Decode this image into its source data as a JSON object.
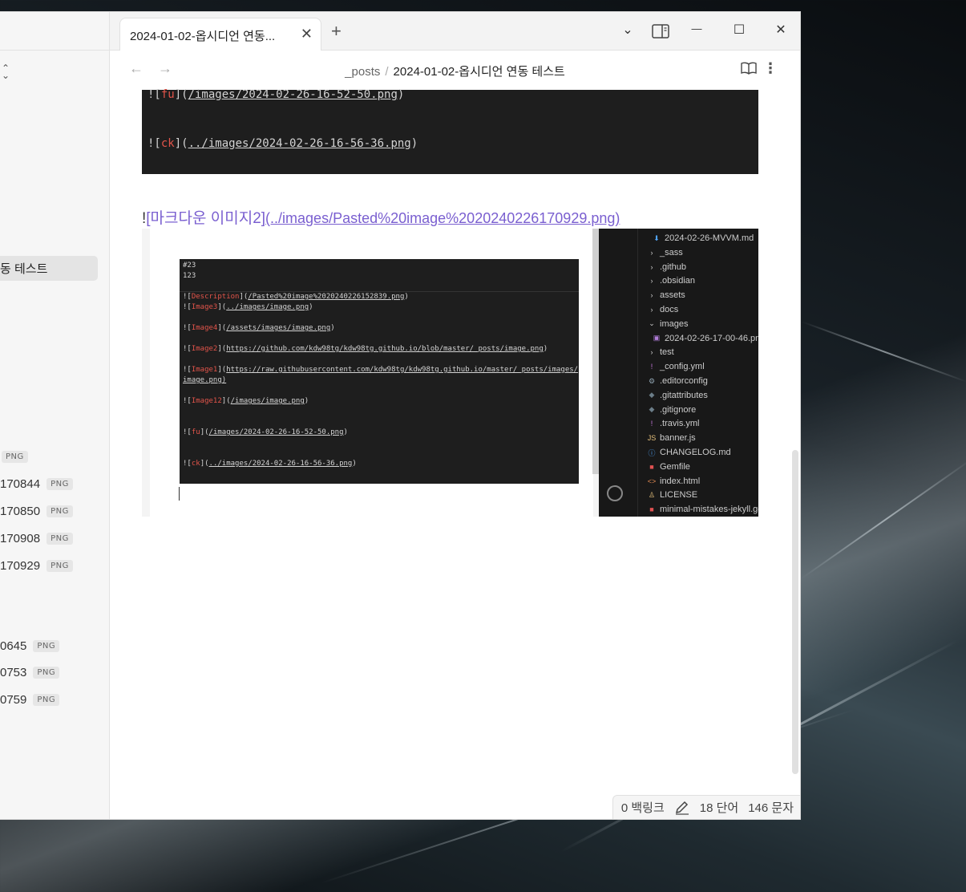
{
  "window": {
    "tab_title": "2024-01-02-옵시디언 연동...",
    "new_tab_symbol": "+",
    "close_tab_symbol": "✕",
    "dropdown_symbol": "⌄",
    "minimize_symbol": "—",
    "maximize_symbol": "☐",
    "close_symbol": "✕"
  },
  "nav": {
    "back_symbol": "←",
    "forward_symbol": "→",
    "breadcrumb_folder": "_posts",
    "breadcrumb_sep": "/",
    "breadcrumb_file": "2024-01-02-옵시디언 연동 테스트",
    "more_symbol": "⋮"
  },
  "sidebar": {
    "active_file": "동 테스트",
    "attachments": [
      {
        "name": "",
        "badge": "PNG"
      },
      {
        "name": "170844",
        "badge": "PNG"
      },
      {
        "name": "170850",
        "badge": "PNG"
      },
      {
        "name": "170908",
        "badge": "PNG"
      },
      {
        "name": "170929",
        "badge": "PNG"
      },
      {
        "name": "0645",
        "badge": "PNG"
      },
      {
        "name": "0753",
        "badge": "PNG"
      },
      {
        "name": "0759",
        "badge": "PNG"
      }
    ]
  },
  "editor": {
    "code_lines": [
      {
        "prefix": "![",
        "alt": "fu",
        "mid": "](",
        "url": "/images/2024-02-26-16-52-50.png",
        "suffix": ")"
      },
      {
        "prefix": "![",
        "alt": "ck",
        "mid": "](",
        "url": "../images/2024-02-26-16-56-36.png",
        "suffix": ")"
      }
    ],
    "md_bang": "!",
    "md_alt": "[마크다운 이미지2]",
    "md_url": "(../images/Pasted%20image%2020240226170929.png)",
    "screenshot_lines": [
      {
        "text": "#23"
      },
      {
        "text": "123"
      },
      {
        "prefix": "![",
        "alt": "Description",
        "mid": "](",
        "url": "/Pasted%20image%2020240226152839.png",
        "suffix": ")"
      },
      {
        "prefix": "![",
        "alt": "Image3",
        "mid": "](",
        "url": "../images/image.png",
        "suffix": ")"
      },
      {
        "prefix": "![",
        "alt": "Image4",
        "mid": "](",
        "url": "/assets/images/image.png",
        "suffix": ")"
      },
      {
        "prefix": "![",
        "alt": "Image2",
        "mid": "](",
        "url": "https://github.com/kdw98tg/kdw98tg.github.io/blob/master/_posts/image.png",
        "suffix": ")"
      },
      {
        "prefix": "![",
        "alt": "Image1",
        "mid": "](",
        "url": "https://raw.githubusercontent.com/kdw98tg/kdw98tg.github.io/master/_posts/images/",
        "suffix": ""
      },
      {
        "text": "image.png)"
      },
      {
        "prefix": "![",
        "alt": "Image12",
        "mid": "](",
        "url": "/images/image.png",
        "suffix": ")"
      },
      {
        "prefix": "![",
        "alt": "fu",
        "mid": "](",
        "url": "/images/2024-02-26-16-52-50.png",
        "suffix": ")"
      },
      {
        "prefix": "![",
        "alt": "ck",
        "mid": "](",
        "url": "../images/2024-02-26-16-56-36.png",
        "suffix": ")"
      }
    ],
    "explorer_items": [
      {
        "icon": "⬇",
        "label": "2024-02-26-MVVM.md",
        "color": "#4fa3f7",
        "indent": 1
      },
      {
        "icon": "›",
        "label": "_sass",
        "color": "#cccccc",
        "indent": 0
      },
      {
        "icon": "›",
        "label": ".github",
        "color": "#cccccc",
        "indent": 0
      },
      {
        "icon": "›",
        "label": ".obsidian",
        "color": "#cccccc",
        "indent": 0
      },
      {
        "icon": "›",
        "label": "assets",
        "color": "#cccccc",
        "indent": 0
      },
      {
        "icon": "›",
        "label": "docs",
        "color": "#cccccc",
        "indent": 0
      },
      {
        "icon": "⌄",
        "label": "images",
        "color": "#cccccc",
        "indent": 0
      },
      {
        "icon": "▣",
        "label": "2024-02-26-17-00-46.png",
        "color": "#b07cd8",
        "indent": 1
      },
      {
        "icon": "›",
        "label": "test",
        "color": "#cccccc",
        "indent": 0
      },
      {
        "icon": "!",
        "label": "_config.yml",
        "color": "#c678dd",
        "indent": 0
      },
      {
        "icon": "⚙",
        "label": ".editorconfig",
        "color": "#8fa3b0",
        "indent": 0
      },
      {
        "icon": "◆",
        "label": ".gitattributes",
        "color": "#6b7d88",
        "indent": 0
      },
      {
        "icon": "◆",
        "label": ".gitignore",
        "color": "#6b7d88",
        "indent": 0
      },
      {
        "icon": "!",
        "label": ".travis.yml",
        "color": "#c678dd",
        "indent": 0
      },
      {
        "icon": "JS",
        "label": "banner.js",
        "color": "#e5c07b",
        "indent": 0
      },
      {
        "icon": "ⓘ",
        "label": "CHANGELOG.md",
        "color": "#4fa3f7",
        "indent": 0
      },
      {
        "icon": "■",
        "label": "Gemfile",
        "color": "#e05252",
        "indent": 0
      },
      {
        "icon": "<>",
        "label": "index.html",
        "color": "#e08a52",
        "indent": 0
      },
      {
        "icon": "♙",
        "label": "LICENSE",
        "color": "#e5c07b",
        "indent": 0
      },
      {
        "icon": "■",
        "label": "minimal-mistakes-jekyll.ge",
        "color": "#e05252",
        "indent": 0
      }
    ]
  },
  "status": {
    "backlinks": "0 백링크",
    "words": "18 단어",
    "chars": "146 문자"
  }
}
